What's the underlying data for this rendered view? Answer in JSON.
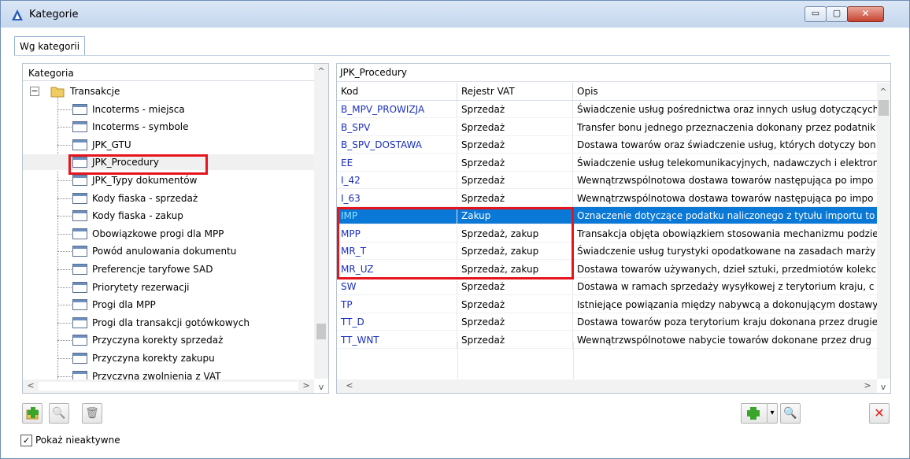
{
  "window": {
    "title": "Kategorie",
    "minimize_glyph": "▭",
    "maximize_glyph": "▢",
    "close_glyph": "✕"
  },
  "tabs": [
    {
      "label": "Wg kategorii",
      "active": true
    }
  ],
  "tree": {
    "header": "Kategoria",
    "root": {
      "label": "Transakcje",
      "expanded": true
    },
    "items": [
      "Incoterms - miejsca",
      "Incoterms - symbole",
      "JPK_GTU",
      "JPK_Procedury",
      "JPK_Typy dokumentów",
      "Kody fiaska - sprzedaż",
      "Kody fiaska - zakup",
      "Obowiązkowe progi dla MPP",
      "Powód anulowania dokumentu",
      "Preferencje taryfowe SAD",
      "Priorytety rezerwacji",
      "Progi dla MPP",
      "Progi dla transakcji gotówkowych",
      "Przyczyna korekty sprzedaż",
      "Przyczyna korekty zakupu",
      "Przyczyna zwolnienia z VAT"
    ],
    "selected_index": 3
  },
  "grid": {
    "title": "JPK_Procedury",
    "columns": [
      "Kod",
      "Rejestr VAT",
      "Opis"
    ],
    "rows": [
      {
        "kod": "B_MPV_PROWIZJA",
        "rejestr": "Sprzedaż",
        "opis": "Świadczenie usług pośrednictwa oraz innych usług dotyczących"
      },
      {
        "kod": "B_SPV",
        "rejestr": "Sprzedaż",
        "opis": "Transfer bonu jednego przeznaczenia dokonany przez podatnik"
      },
      {
        "kod": "B_SPV_DOSTAWA",
        "rejestr": "Sprzedaż",
        "opis": "Dostawa towarów oraz świadczenie usług, których dotyczy bon"
      },
      {
        "kod": "EE",
        "rejestr": "Sprzedaż",
        "opis": "Świadczenie usług telekomunikacyjnych, nadawczych i elektron"
      },
      {
        "kod": "I_42",
        "rejestr": "Sprzedaż",
        "opis": "Wewnątrzwspólnotowa dostawa towarów następująca po impo"
      },
      {
        "kod": "I_63",
        "rejestr": "Sprzedaż",
        "opis": "Wewnątrzwspólnotowa dostawa towarów następująca po impo"
      },
      {
        "kod": "IMP",
        "rejestr": "Zakup",
        "opis": "Oznaczenie dotyczące podatku naliczonego z tytułu importu to"
      },
      {
        "kod": "MPP",
        "rejestr": "Sprzedaż, zakup",
        "opis": "Transakcja objęta obowiązkiem stosowania mechanizmu podzie"
      },
      {
        "kod": "MR_T",
        "rejestr": "Sprzedaż, zakup",
        "opis": "Świadczenie usług turystyki opodatkowane na zasadach marży"
      },
      {
        "kod": "MR_UZ",
        "rejestr": "Sprzedaż, zakup",
        "opis": "Dostawa towarów używanych, dzieł sztuki, przedmiotów kolekc"
      },
      {
        "kod": "SW",
        "rejestr": "Sprzedaż",
        "opis": "Dostawa w ramach sprzedaży wysyłkowej z terytorium kraju, c"
      },
      {
        "kod": "TP",
        "rejestr": "Sprzedaż",
        "opis": "Istniejące powiązania między nabywcą a dokonującym dostawy"
      },
      {
        "kod": "TT_D",
        "rejestr": "Sprzedaż",
        "opis": "Dostawa towarów poza terytorium kraju dokonana przez drugie"
      },
      {
        "kod": "TT_WNT",
        "rejestr": "Sprzedaż",
        "opis": "Wewnątrzwspólnotowe nabycie towarów dokonane przez drug"
      }
    ],
    "selected_index": 6
  },
  "checkbox": {
    "label": "Pokaż nieaktywne",
    "checked": true,
    "glyph": "✓"
  },
  "glyphs": {
    "up": "^",
    "down": "v",
    "left": "<",
    "right": ">",
    "minus": "−",
    "plus": "+",
    "search": "🔍",
    "trash": "🗑",
    "close_x": "✕",
    "dropdown": "▾"
  },
  "colors": {
    "selection": "#0a78d7",
    "code_text": "#1a2fbf",
    "highlight_box": "#e5151d",
    "add_green": "#3aa42b",
    "delete_red": "#e0201c"
  }
}
